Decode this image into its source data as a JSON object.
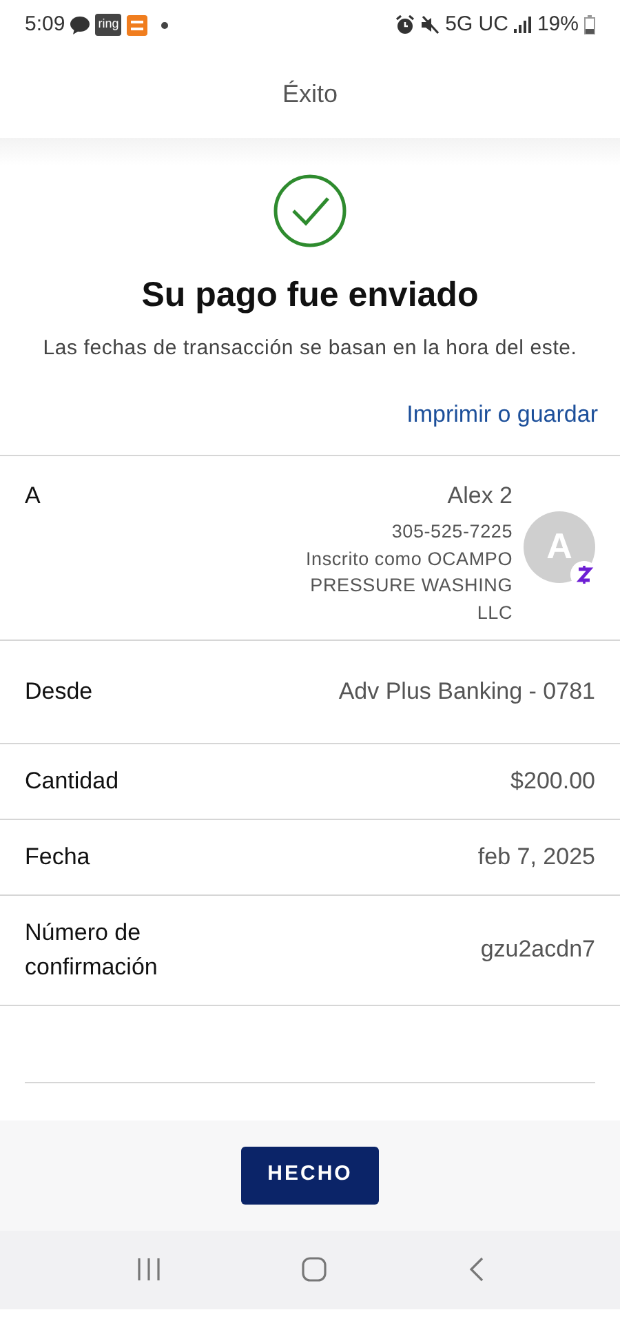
{
  "status_bar": {
    "time": "5:09",
    "ring_badge": "ring",
    "network": "5G UC",
    "battery": "19%"
  },
  "header": {
    "title": "Éxito"
  },
  "result": {
    "heading": "Su pago fue enviado",
    "note": "Las fechas de transacción se basan en la hora del este.",
    "link": "Imprimir o guardar"
  },
  "details": [
    {
      "kind": "recipient",
      "label": "A",
      "name": "Alex 2",
      "phone": "305-525-7225",
      "enrolled": "Inscrito como OCAMPO PRESSURE WASHING LLC",
      "avatar": "A"
    },
    {
      "kind": "field",
      "label": "Desde",
      "value": "Adv Plus Banking - 0781"
    },
    {
      "kind": "field",
      "label": "Cantidad",
      "value": "$200.00"
    },
    {
      "kind": "field",
      "label": "Fecha",
      "value": "feb 7, 2025"
    },
    {
      "kind": "field",
      "label": "Número de confirmación",
      "value": "gzu2acdn7"
    }
  ],
  "done_button": "HECHO"
}
